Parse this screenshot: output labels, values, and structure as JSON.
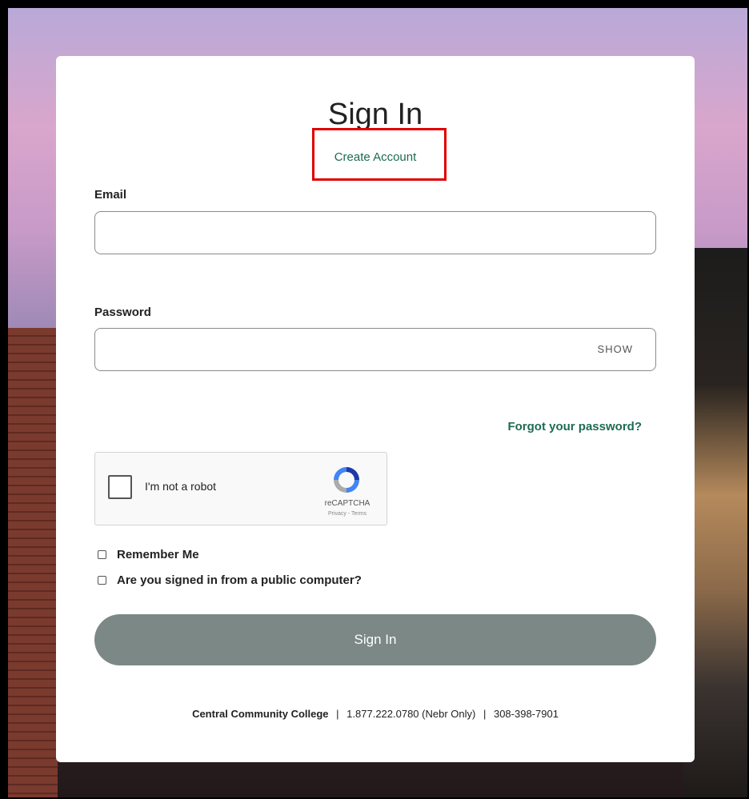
{
  "page": {
    "title": "Sign In",
    "create_account": "Create Account"
  },
  "form": {
    "email_label": "Email",
    "email_value": "",
    "password_label": "Password",
    "password_value": "",
    "show_label": "SHOW",
    "forgot_label": "Forgot your password?"
  },
  "captcha": {
    "text": "I'm not a robot",
    "brand": "reCAPTCHA",
    "links": "Privacy - Terms"
  },
  "options": {
    "remember_me": "Remember Me",
    "public_computer": "Are you signed in from a public computer?"
  },
  "submit": {
    "label": "Sign In"
  },
  "footer": {
    "school": "Central Community College",
    "separator": "|",
    "phone1": "1.877.222.0780  (Nebr Only)",
    "phone2": "308-398-7901"
  },
  "colors": {
    "accent": "#1d6b54",
    "button": "#7b8886",
    "highlight": "#e00000"
  }
}
